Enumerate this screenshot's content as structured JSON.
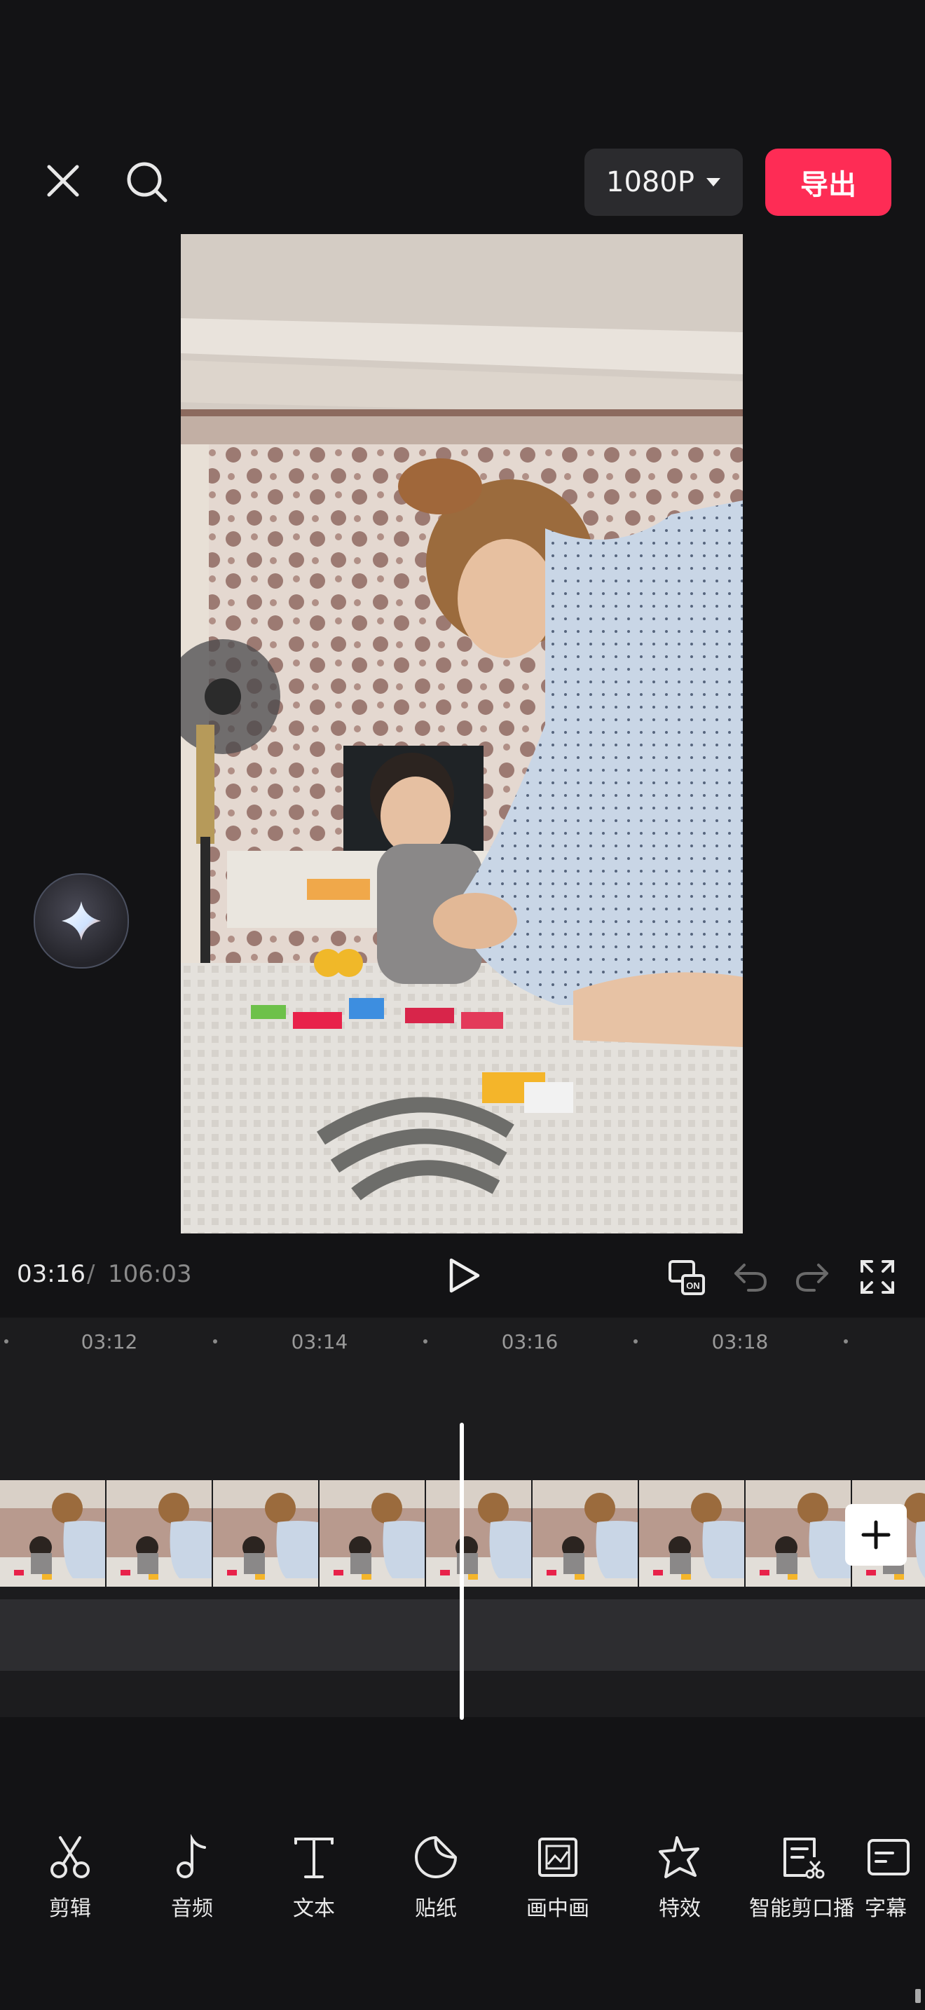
{
  "header": {
    "resolution_label": "1080P",
    "export_label": "导出"
  },
  "player": {
    "current_time": "03:16",
    "separator": "/",
    "total_time": "106:03"
  },
  "timeline": {
    "ticks": [
      "03:12",
      "03:14",
      "03:16",
      "03:18"
    ]
  },
  "toolbar": {
    "items": [
      {
        "label": "剪辑",
        "icon": "scissors-icon"
      },
      {
        "label": "音频",
        "icon": "music-note-icon"
      },
      {
        "label": "文本",
        "icon": "text-icon"
      },
      {
        "label": "贴纸",
        "icon": "sticker-icon"
      },
      {
        "label": "画中画",
        "icon": "picture-in-picture-icon"
      },
      {
        "label": "特效",
        "icon": "effects-star-icon"
      },
      {
        "label": "智能剪口播",
        "icon": "smart-cut-icon"
      },
      {
        "label": "字幕",
        "icon": "captions-icon"
      }
    ]
  },
  "colors": {
    "accent": "#fe2c55",
    "background": "#131315"
  }
}
